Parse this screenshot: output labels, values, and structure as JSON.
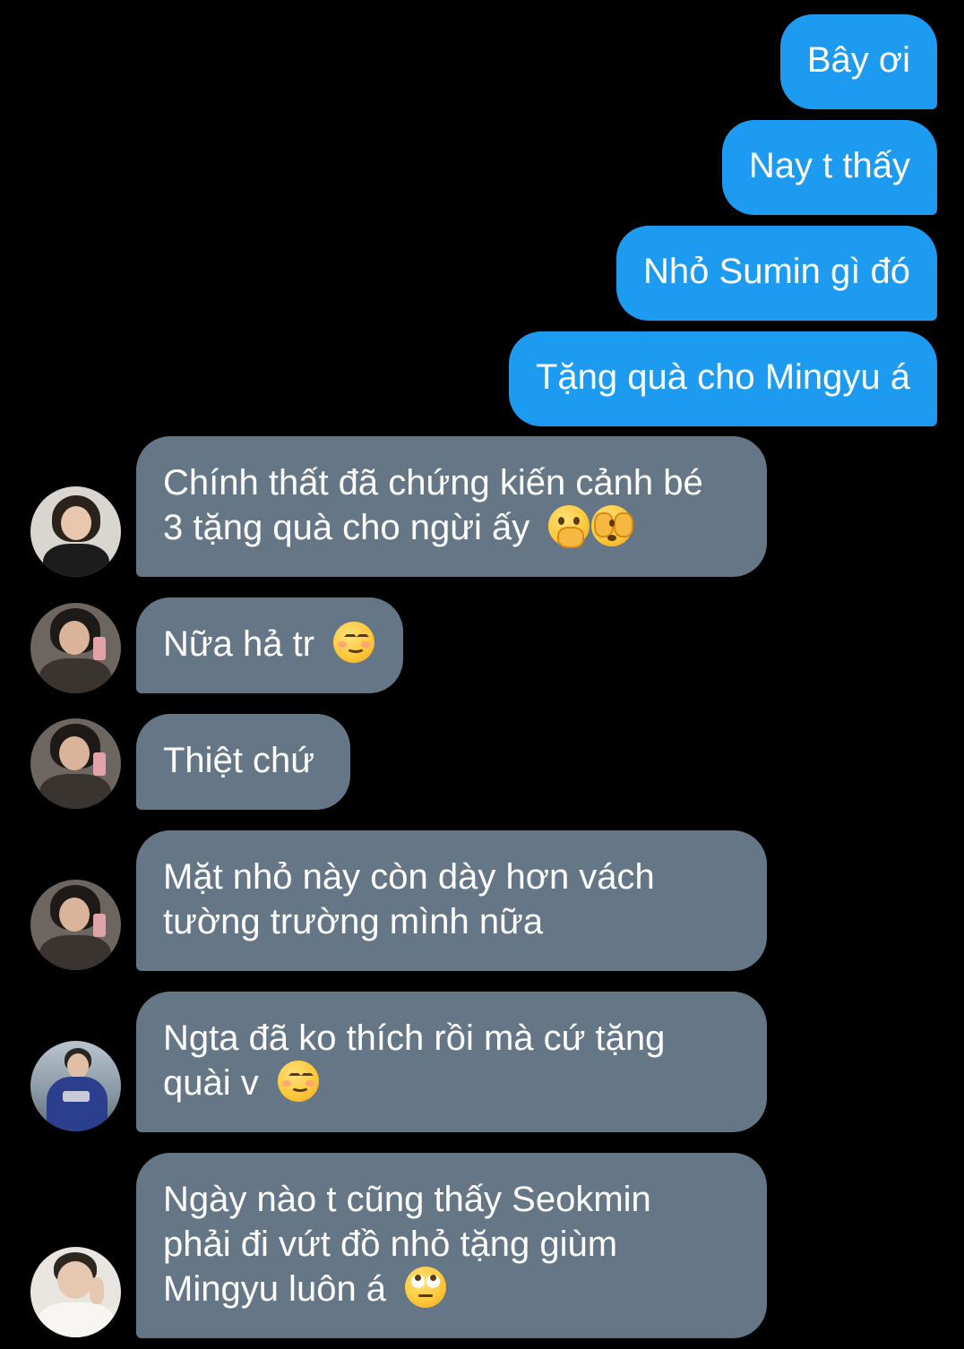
{
  "messages": [
    {
      "direction": "outgoing",
      "lines": [
        "Bây ơi"
      ]
    },
    {
      "direction": "outgoing",
      "lines": [
        "Nay t thấy"
      ]
    },
    {
      "direction": "outgoing",
      "lines": [
        "Nhỏ Sumin gì đó"
      ]
    },
    {
      "direction": "outgoing",
      "lines": [
        "Tặng quà cho Mingyu á"
      ]
    },
    {
      "direction": "incoming",
      "lines": [
        "Chính thất đã chứng kiến cảnh bé",
        "3 tặng quà cho ngừi ấy"
      ],
      "emojis": [
        "face-with-hand-over-mouth-icon",
        "face-with-peeking-eye-icon"
      ]
    },
    {
      "direction": "incoming",
      "lines": [
        "Nữa hả tr"
      ],
      "emojis": [
        "smiling-face-with-smiling-eyes-icon"
      ]
    },
    {
      "direction": "incoming",
      "lines": [
        "Thiệt chứ"
      ]
    },
    {
      "direction": "incoming",
      "lines": [
        "Mặt nhỏ này còn dày hơn vách",
        "tường trường mình nữa"
      ]
    },
    {
      "direction": "incoming",
      "lines": [
        "Ngta đã ko thích rồi mà cứ tặng",
        "quài v"
      ],
      "emojis": [
        "smiling-face-with-smiling-eyes-icon"
      ]
    },
    {
      "direction": "incoming",
      "lines": [
        "Ngày nào t cũng thấy Seokmin",
        "phải đi vứt đồ nhỏ tặng giùm",
        "Mingyu luôn á"
      ],
      "emojis": [
        "face-with-rolling-eyes-icon"
      ]
    }
  ],
  "colors": {
    "background": "#000000",
    "outgoing_bubble": "#1d9bf0",
    "incoming_bubble": "#657786",
    "text": "#ffffff"
  }
}
